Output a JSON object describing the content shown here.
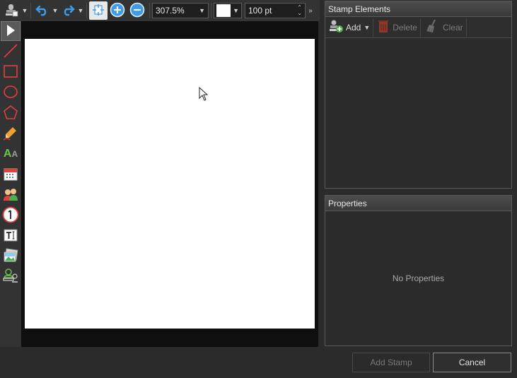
{
  "toolbar": {
    "zoom_value": "307.5%",
    "color_value": "#ffffff",
    "stroke_value": "100 pt"
  },
  "tools": [
    {
      "name": "select-tool",
      "icon": "arrow-pointer-icon"
    },
    {
      "name": "line-tool",
      "icon": "line-icon"
    },
    {
      "name": "rectangle-tool",
      "icon": "rectangle-icon"
    },
    {
      "name": "ellipse-tool",
      "icon": "ellipse-icon"
    },
    {
      "name": "polygon-tool",
      "icon": "pentagon-icon"
    },
    {
      "name": "pencil-tool",
      "icon": "pencil-icon"
    },
    {
      "name": "text-style-tool",
      "icon": "text-aa-icon"
    },
    {
      "name": "date-tool",
      "icon": "calendar-icon"
    },
    {
      "name": "user-tool",
      "icon": "users-icon"
    },
    {
      "name": "number-tool",
      "icon": "circled-one-icon"
    },
    {
      "name": "textbox-tool",
      "icon": "textbox-icon"
    },
    {
      "name": "image-tool",
      "icon": "image-icon"
    },
    {
      "name": "stamp-tool",
      "icon": "stamp-icon"
    }
  ],
  "stamp_panel": {
    "title": "Stamp Elements",
    "add_label": "Add",
    "delete_label": "Delete",
    "clear_label": "Clear"
  },
  "properties_panel": {
    "title": "Properties",
    "empty_text": "No Properties"
  },
  "footer": {
    "add_stamp_label": "Add Stamp",
    "cancel_label": "Cancel"
  },
  "colors": {
    "accent_blue": "#3d9be9",
    "tool_red": "#e04040",
    "add_green": "#4caf50"
  }
}
